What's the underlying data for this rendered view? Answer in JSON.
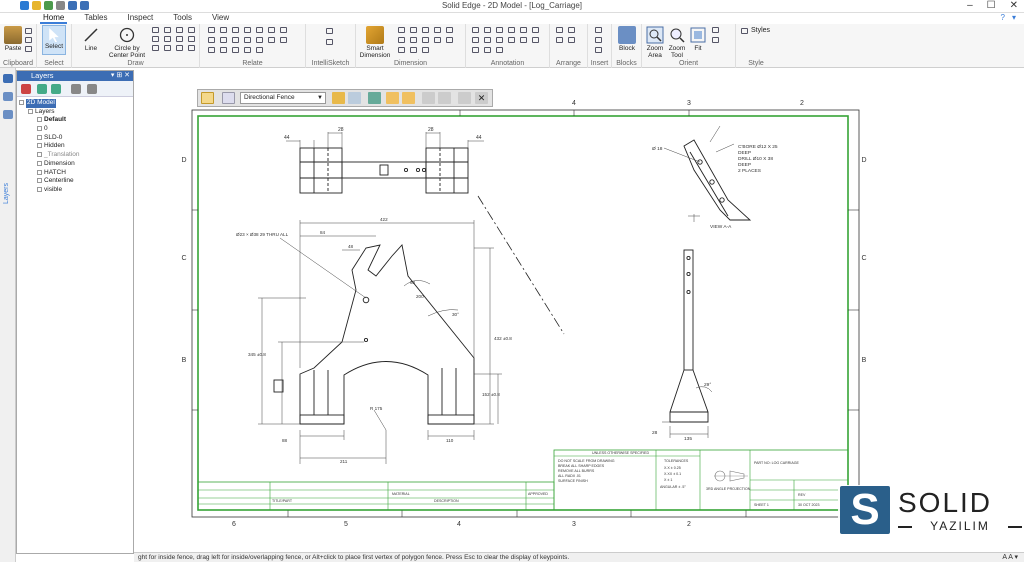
{
  "window": {
    "title": "Solid Edge - 2D Model - [Log_Carriage]",
    "min": "–",
    "max": "☐",
    "close": "✕"
  },
  "tabs": [
    "Home",
    "Tables",
    "Inspect",
    "Tools",
    "View"
  ],
  "tabs_right": [
    "?",
    "▾"
  ],
  "ribbon": {
    "clipboard": {
      "label": "Clipboard",
      "paste": "Paste"
    },
    "select": {
      "label": "Select",
      "btn": "Select"
    },
    "draw": {
      "label": "Draw",
      "line": "Line",
      "circle": "Circle by Center Point"
    },
    "relate": {
      "label": "Relate"
    },
    "intellisketch": {
      "label": "IntelliSketch"
    },
    "dimension": {
      "label": "Dimension",
      "smart": "Smart Dimension"
    },
    "annotation": {
      "label": "Annotation"
    },
    "arrange": {
      "label": "Arrange"
    },
    "insert": {
      "label": "Insert"
    },
    "blocks": {
      "label": "Blocks",
      "block": "Block"
    },
    "orient": {
      "label": "Orient",
      "zoom_area": "Zoom Area",
      "zoom_tool": "Zoom Tool",
      "fit": "Fit"
    },
    "style": {
      "label": "Style",
      "styles": "Styles"
    }
  },
  "layers": {
    "title": "Layers",
    "items": [
      {
        "text": "2D Model",
        "indent": 1,
        "selected": true
      },
      {
        "text": "Layers",
        "indent": 2
      },
      {
        "text": "Default",
        "indent": 3,
        "bold": true
      },
      {
        "text": "0",
        "indent": 3
      },
      {
        "text": "SLD-0",
        "indent": 3
      },
      {
        "text": "Hidden",
        "indent": 3
      },
      {
        "text": "_Translation",
        "indent": 3,
        "gray": true
      },
      {
        "text": "Dimension",
        "indent": 3
      },
      {
        "text": "HATCH",
        "indent": 3
      },
      {
        "text": "Centerline",
        "indent": 3
      },
      {
        "text": "visible",
        "indent": 3
      }
    ]
  },
  "leftstrip": {
    "tab": "Layers"
  },
  "fence": {
    "mode": "Directional Fence"
  },
  "status": {
    "text": "ght for inside fence, drag left for inside/overlapping fence, or Alt+click to place first vertex of polygon fence. Press Esc to clear the display of keypoints.",
    "zoom": "A A ▾"
  },
  "drawing": {
    "zones_top": [
      "4",
      "3",
      "2"
    ],
    "zones_bottom": [
      "6",
      "5",
      "4",
      "3",
      "2"
    ],
    "zones_left": [
      "D",
      "C",
      "B"
    ],
    "zones_right": [
      "D",
      "C",
      "B"
    ],
    "dims": {
      "d28a": "28",
      "d28b": "28",
      "d44a": "44",
      "d44b": "44",
      "d422": "422",
      "d84": "84",
      "d48": "48",
      "hole_note": "Ø23 × Ø38 29 THRU ALL",
      "d60": "60",
      "d30": "30°",
      "d345": "345 ±0.8",
      "d432": "432 ±0.8",
      "d152": "152 ±0.8",
      "d88": "88",
      "d110": "110",
      "d211": "211",
      "dr": "R 175",
      "d200": "200",
      "d29": "29°",
      "d28c": "28",
      "d135": "135",
      "d18": "18"
    },
    "detail_notes": [
      "C'BORE Ø12 X 25",
      "DEEP",
      "DRILL Ø10 X 38",
      "DEEP",
      "2 PLACES"
    ],
    "detail_dim": "Ø 18",
    "detail_title": "VIEW A-A",
    "tb": {
      "unless": "UNLESS OTHERWISE SPECIFIED",
      "notes": [
        "DO NOT SCALE FROM DRAWING",
        "BREAK ALL SHARP EDGES",
        "REMOVE ALL BURRS",
        "ALL RADII .01",
        "SURFACE FINISH"
      ],
      "tol_head": "TOLERANCES",
      "tols": [
        "X.X ± 0.25",
        "X.XX ± 0.1",
        "X ± 1",
        "ANGULAR ± .5°"
      ],
      "part_name": "PART NO: LOG CARRIAGE",
      "scale_label": "3RD ANGLE PROJECTION",
      "rev": "REV",
      "date": "30 OCT 2023",
      "sheet": "SHEET 1",
      "material": "MATERIAL",
      "desc": "DESCRIPTION",
      "total": "TITLE/PART",
      "appr": "APPROVED"
    }
  },
  "logo": {
    "letter": "S",
    "name": "SOLID",
    "sub": "YAZILIM",
    "color": "#2a5f8a"
  }
}
